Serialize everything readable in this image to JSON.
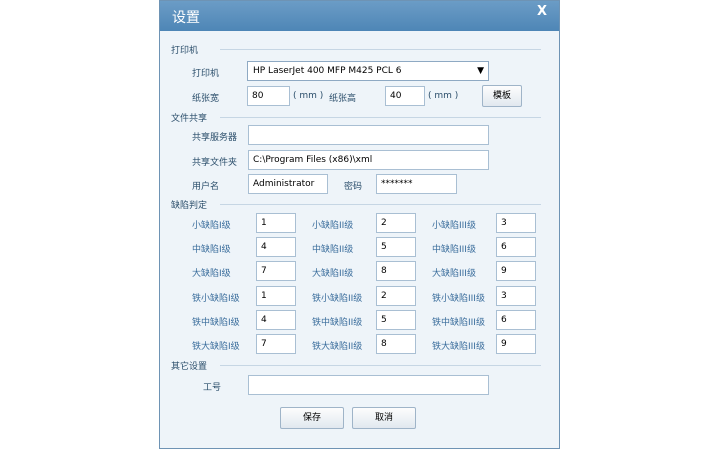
{
  "dialog": {
    "title": "设置",
    "close_glyph": "X"
  },
  "printer": {
    "section": "打印机",
    "label": "打印机",
    "selected": "HP LaserJet 400 MFP M425 PCL 6",
    "paper_width_label": "纸张宽",
    "paper_width": "80",
    "paper_width_unit": "( mm )",
    "paper_height_label": "纸张高",
    "paper_height": "40",
    "paper_height_unit": "( mm )",
    "template_button": "模板"
  },
  "share": {
    "section": "文件共享",
    "server_label": "共享服务器",
    "server": "",
    "folder_label": "共享文件夹",
    "folder": "C:\\Program Files (x86)\\xml",
    "user_label": "用户名",
    "user": "Administrator",
    "password_label": "密码",
    "password": "*******"
  },
  "defects": {
    "section": "缺陷判定",
    "rows": [
      [
        {
          "label": "小缺陷I级",
          "value": "1"
        },
        {
          "label": "小缺陷II级",
          "value": "2"
        },
        {
          "label": "小缺陷III级",
          "value": "3"
        }
      ],
      [
        {
          "label": "中缺陷I级",
          "value": "4"
        },
        {
          "label": "中缺陷II级",
          "value": "5"
        },
        {
          "label": "中缺陷III级",
          "value": "6"
        }
      ],
      [
        {
          "label": "大缺陷I级",
          "value": "7"
        },
        {
          "label": "大缺陷II级",
          "value": "8"
        },
        {
          "label": "大缺陷III级",
          "value": "9"
        }
      ],
      [
        {
          "label": "铁小缺陷I级",
          "value": "1"
        },
        {
          "label": "铁小缺陷II级",
          "value": "2"
        },
        {
          "label": "铁小缺陷III级",
          "value": "3"
        }
      ],
      [
        {
          "label": "铁中缺陷I级",
          "value": "4"
        },
        {
          "label": "铁中缺陷II级",
          "value": "5"
        },
        {
          "label": "铁中缺陷III级",
          "value": "6"
        }
      ],
      [
        {
          "label": "铁大缺陷I级",
          "value": "7"
        },
        {
          "label": "铁大缺陷II级",
          "value": "8"
        },
        {
          "label": "铁大缺陷III级",
          "value": "9"
        }
      ]
    ]
  },
  "other": {
    "section": "其它设置",
    "worker_label": "工号",
    "worker": ""
  },
  "actions": {
    "save": "保存",
    "cancel": "取消"
  },
  "colors": {
    "titlebar": "#5a90be",
    "body": "#eef4f9",
    "text": "#2b4e6b"
  }
}
